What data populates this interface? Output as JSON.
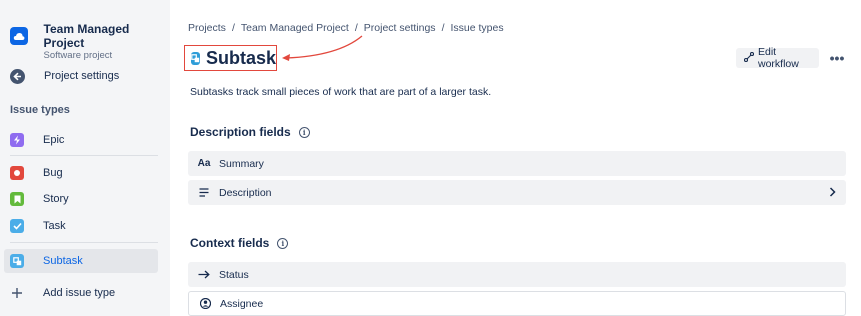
{
  "project": {
    "name": "Team Managed Project",
    "type": "Software project"
  },
  "sidebar": {
    "back_label": "Project settings",
    "section_heading": "Issue types",
    "items": [
      {
        "label": "Epic",
        "color": "#8f6cf0"
      },
      {
        "label": "Bug",
        "color": "#e2483d"
      },
      {
        "label": "Story",
        "color": "#63ba3c"
      },
      {
        "label": "Task",
        "color": "#4bade8"
      },
      {
        "label": "Subtask",
        "color": "#4bade8"
      }
    ],
    "add_label": "Add issue type"
  },
  "breadcrumb": [
    "Projects",
    "Team Managed Project",
    "Project settings",
    "Issue types"
  ],
  "breadcrumb_separator": "/",
  "page": {
    "title": "Subtask",
    "description": "Subtasks track small pieces of work that are part of a larger task."
  },
  "toolbar": {
    "edit_workflow_label": "Edit workflow",
    "more_label": "•••"
  },
  "description_fields": {
    "title": "Description fields",
    "fields": [
      {
        "label": "Summary",
        "icon_text": "Aa"
      },
      {
        "label": "Description"
      }
    ]
  },
  "context_fields": {
    "title": "Context fields",
    "fields": [
      {
        "label": "Status"
      },
      {
        "label": "Assignee"
      }
    ]
  },
  "colors": {
    "accent": "#0c66e4",
    "highlight": "#e2483d"
  }
}
